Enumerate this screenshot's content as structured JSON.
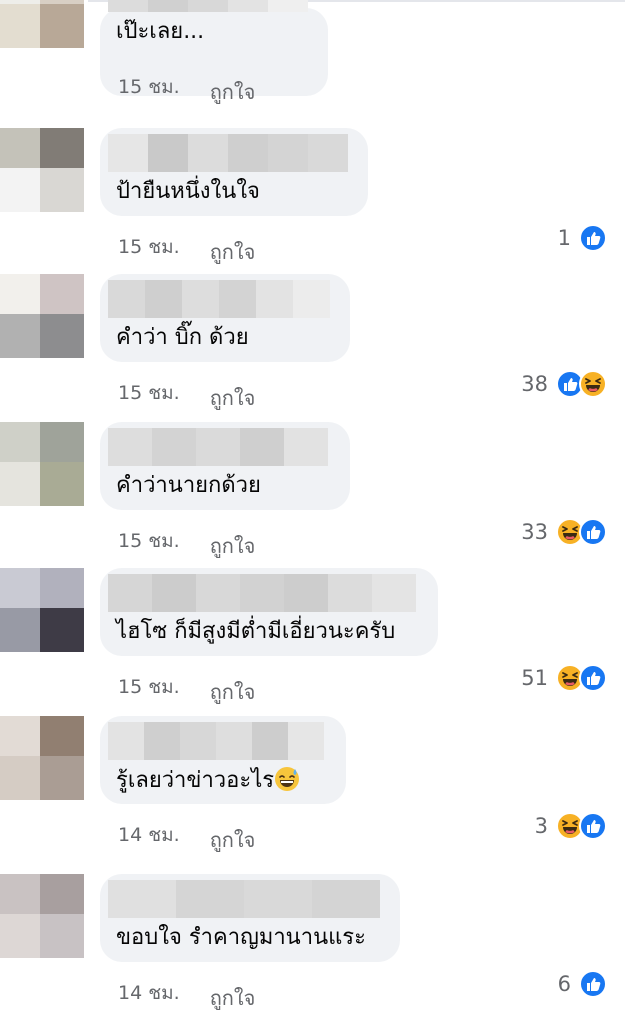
{
  "comments": [
    {
      "text": "เป๊ะเลย...",
      "time": "15 ชม.",
      "like_label": "ถูกใจ",
      "reaction_count": "",
      "reactions": [],
      "bubble_width": 228,
      "avatar_colors": [
        "#eeeeea",
        "#d8cfc4",
        "#e3ddd0",
        "#b8a897"
      ],
      "name_blur_colors": [
        "#dcdcdc",
        "#d0d0d0",
        "#d8d8d8",
        "#e3e3e3",
        "#efefef"
      ]
    },
    {
      "text": "ป้ายืนหนึ่งในใจ",
      "time": "15 ชม.",
      "like_label": "ถูกใจ",
      "reaction_count": "1",
      "reactions": [
        "like-icon"
      ],
      "bubble_width": 268,
      "avatar_colors": [
        "#c4c2b9",
        "#817c76",
        "#f3f3f3",
        "#d9d7d3"
      ],
      "name_blur_colors": [
        "#e6e6e6",
        "#c9c9c9",
        "#dcdcdc",
        "#cfcfcf",
        "#d4d4d4",
        "#d9d9d9"
      ]
    },
    {
      "text": "คำว่า บิ๊ก ด้วย",
      "time": "15 ชม.",
      "like_label": "ถูกใจ",
      "reaction_count": "38",
      "reactions": [
        "like-icon",
        "laugh-icon"
      ],
      "bubble_width": 250,
      "avatar_colors": [
        "#f2f0ec",
        "#cfc4c4",
        "#b1b1b1",
        "#8d8d8f"
      ],
      "name_blur_colors": [
        "#d9d9d9",
        "#cfcfcf",
        "#dddddd",
        "#d3d3d3",
        "#e3e3e3",
        "#ececec"
      ]
    },
    {
      "text": "คำว่านายกด้วย",
      "time": "15 ชม.",
      "like_label": "ถูกใจ",
      "reaction_count": "33",
      "reactions": [
        "laugh-icon",
        "like-icon"
      ],
      "bubble_width": 250,
      "avatar_colors": [
        "#cfd0c8",
        "#9fa39a",
        "#e5e4de",
        "#a9ab95"
      ],
      "name_blur_colors": [
        "#dddddd",
        "#d3d3d3",
        "#dadada",
        "#cfcfcf",
        "#e2e2e2"
      ]
    },
    {
      "text": "ไฮโซ ก็มีสูงมีต่ำมีเอี่ยวนะครับ",
      "time": "15 ชม.",
      "like_label": "ถูกใจ",
      "reaction_count": "51",
      "reactions": [
        "laugh-icon",
        "like-icon"
      ],
      "bubble_width": 338,
      "avatar_colors": [
        "#c9cad3",
        "#b1b1bd",
        "#989aa5",
        "#3e3b46"
      ],
      "name_blur_colors": [
        "#d6d6d6",
        "#cccccc",
        "#d8d8d8",
        "#d2d2d2",
        "#cdcdcd",
        "#dcdcdc",
        "#e4e4e4"
      ]
    },
    {
      "text": "รู้เลยว่าข่าวอะไร",
      "time": "14 ชม.",
      "like_label": "ถูกใจ",
      "reaction_count": "3",
      "reactions": [
        "laugh-icon",
        "like-icon"
      ],
      "bubble_width": 246,
      "avatar_colors": [
        "#e2dbd5",
        "#917f71",
        "#d5ccc4",
        "#aa9d94"
      ],
      "name_blur_colors": [
        "#e3e3e3",
        "#cfcfcf",
        "#d7d7d7",
        "#dedede",
        "#cdcdcd",
        "#e6e6e6"
      ]
    },
    {
      "text": "ขอบใจ รำคาญมานานแระ",
      "time": "14 ชม.",
      "like_label": "ถูกใจ",
      "reaction_count": "6",
      "reactions": [
        "like-icon"
      ],
      "bubble_width": 300,
      "avatar_colors": [
        "#c9c2c2",
        "#a89f9f",
        "#ddd7d5",
        "#c8c2c4"
      ],
      "name_blur_colors": [
        "#e0e0e0",
        "#d5d5d5",
        "#d9d9d9",
        "#d4d4d4"
      ]
    }
  ]
}
